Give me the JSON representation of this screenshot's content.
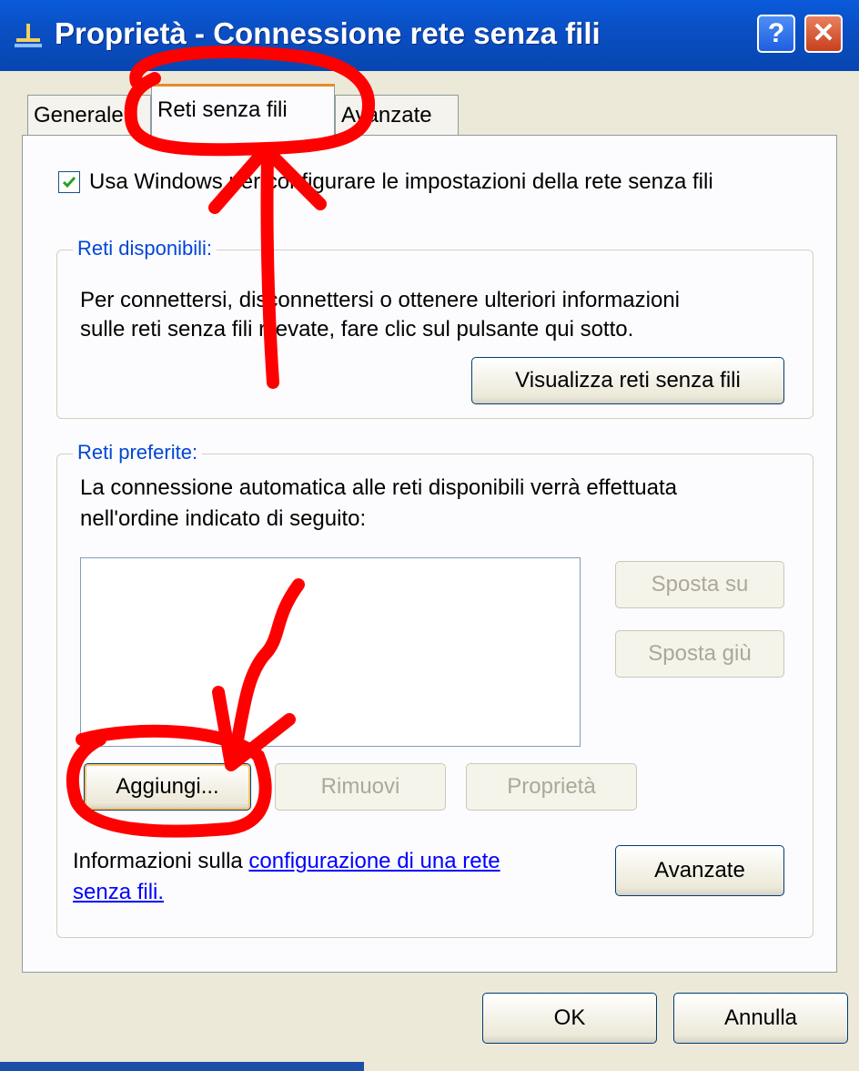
{
  "window": {
    "title": "Proprietà - Connessione rete senza fili",
    "help_glyph": "?",
    "close_glyph": "✕"
  },
  "tabs": [
    {
      "label": "Generale",
      "selected": false
    },
    {
      "label": "Reti senza fili",
      "selected": true
    },
    {
      "label": "Avanzate",
      "selected": false
    }
  ],
  "wireless": {
    "use_windows_checkbox": {
      "label": "Usa Windows per configurare le impostazioni della rete senza fili",
      "checked": true
    },
    "available": {
      "title": "Reti disponibili:",
      "desc_line1": "Per connettersi, disconnettersi o ottenere ulteriori informazioni",
      "desc_line2": "sulle reti senza fili rilevate, fare clic sul pulsante qui sotto.",
      "view_button": "Visualizza reti senza fili"
    },
    "preferred": {
      "title": "Reti preferite:",
      "desc_line1": "La connessione automatica alle reti disponibili verrà effettuata",
      "desc_line2": "nell'ordine indicato di seguito:",
      "networks": [],
      "move_up": "Sposta su",
      "move_down": "Sposta giù",
      "add": "Aggiungi...",
      "remove": "Rimuovi",
      "properties": "Proprietà"
    },
    "info_prefix": "Informazioni sulla ",
    "info_link_line1": "configurazione di una rete",
    "info_link_line2": "senza fili.",
    "advanced_button": "Avanzate"
  },
  "footer": {
    "ok": "OK",
    "cancel": "Annulla"
  },
  "colors": {
    "title_bar": "#0a4fc4",
    "dialog_bg": "#ece9d8",
    "group_title": "#0046d5",
    "annotation": "#ff0000"
  },
  "icons": {
    "title": "network-connection-icon"
  }
}
